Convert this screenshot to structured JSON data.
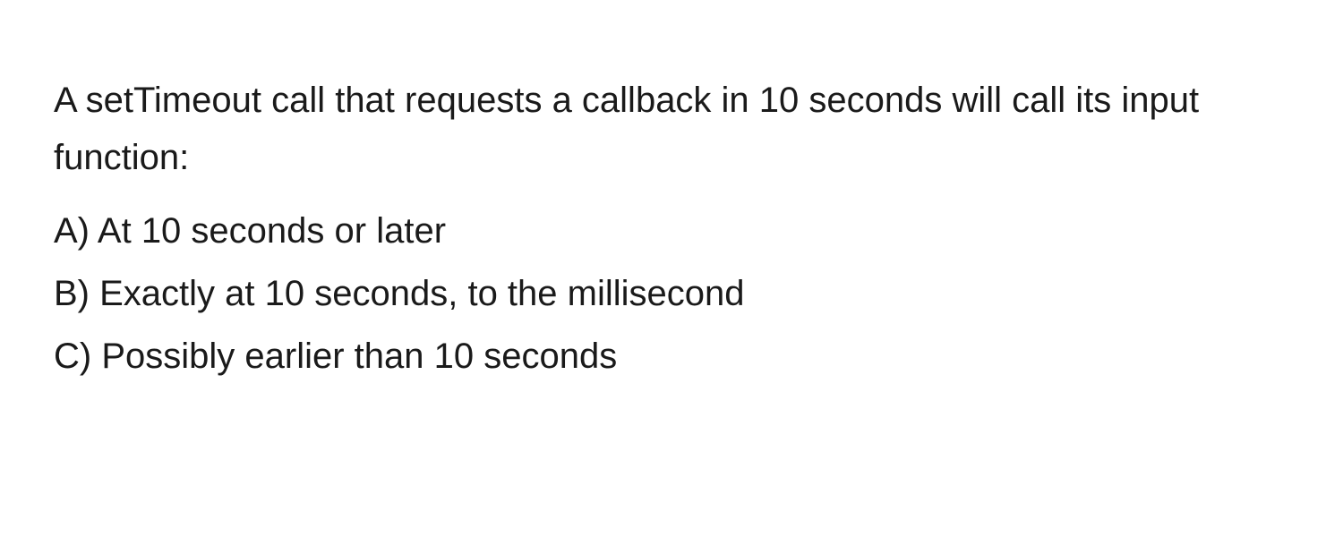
{
  "question": {
    "stem": "A setTimeout call that requests a callback in 10 seconds will call its input function:",
    "options": [
      {
        "label": "A)",
        "text": "At 10 seconds or later"
      },
      {
        "label": "B)",
        "text": "Exactly at 10 seconds, to the millisecond"
      },
      {
        "label": "C)",
        "text": "Possibly earlier than 10 seconds"
      }
    ]
  }
}
